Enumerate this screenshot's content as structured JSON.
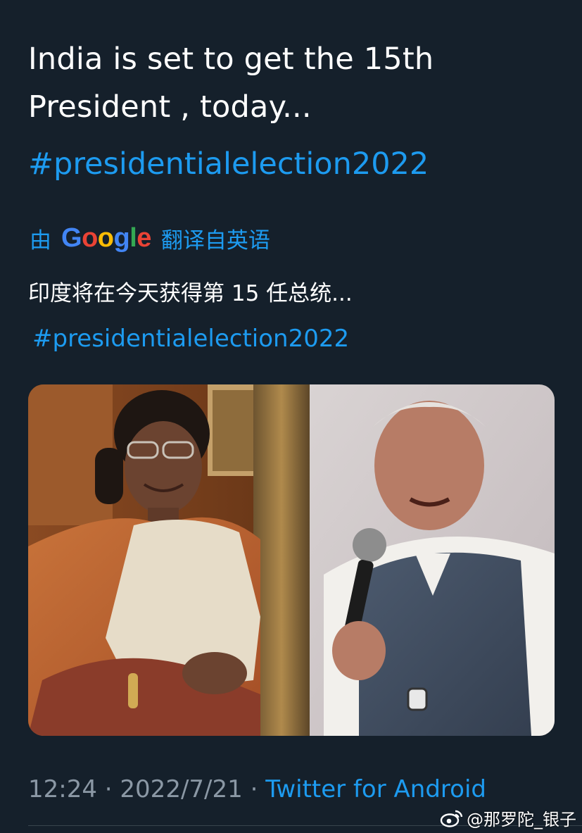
{
  "tweet": {
    "text_line1": "India is set to get the 15th",
    "text_line2": "President , today...",
    "hashtag": "#presidentialelection2022"
  },
  "translation": {
    "by_label": "由",
    "google_logo_text": "Google",
    "suffix_label": "翻译自英语",
    "text": "印度将在今天获得第 15 任总统...",
    "hashtag": "#presidentialelection2022"
  },
  "meta": {
    "time": "12:24",
    "separator": "·",
    "date": "2022/7/21",
    "source": "Twitter for Android"
  },
  "watermark": {
    "icon": "weibo-icon",
    "text": "@那罗陀_银子"
  },
  "colors": {
    "background": "#15202b",
    "link": "#1d9bf0",
    "secondary_text": "#8b98a5",
    "google_blue": "#4285f4",
    "google_red": "#ea4335",
    "google_yellow": "#fbbc05",
    "google_green": "#34a853"
  }
}
